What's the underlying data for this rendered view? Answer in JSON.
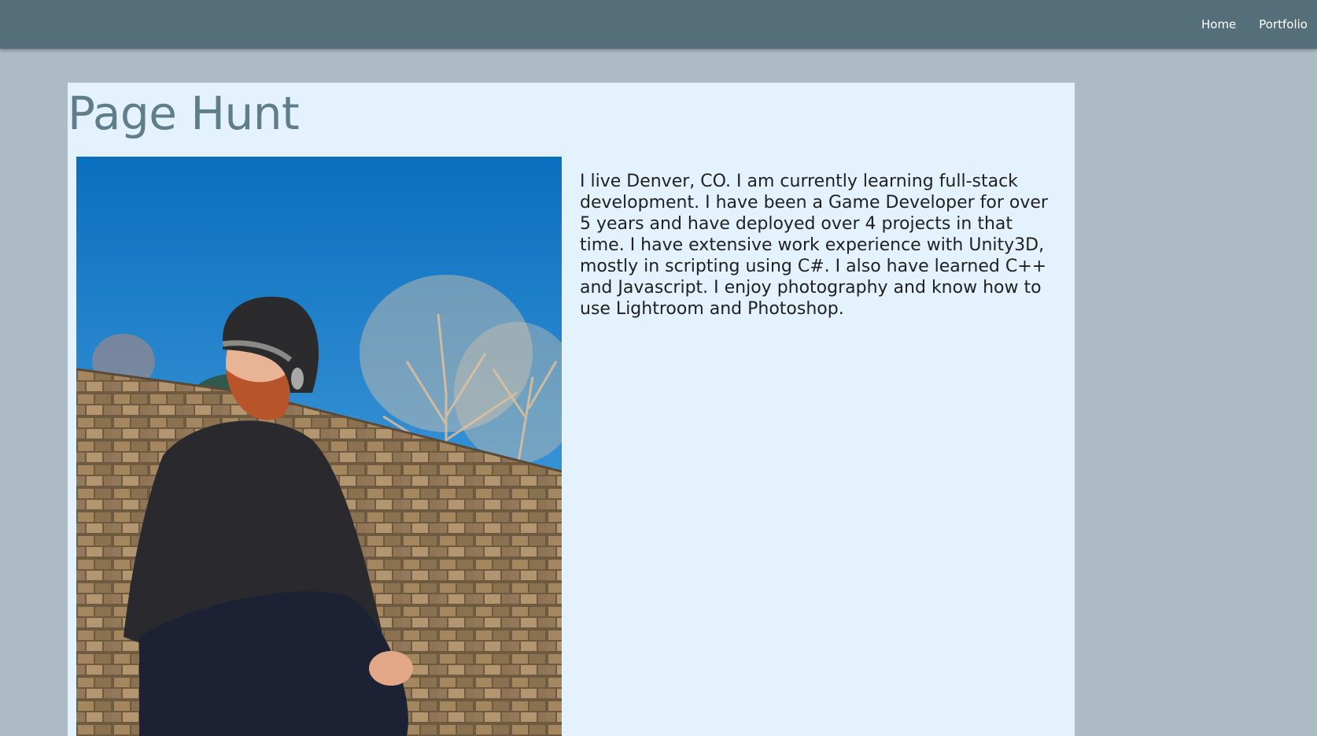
{
  "nav": {
    "items": [
      {
        "label": "Home"
      },
      {
        "label": "Portfolio"
      }
    ]
  },
  "profile": {
    "name": "Page Hunt",
    "bio": "I live Denver, CO. I am currently learning full-stack development. I have been a Game Developer for over 5 years and have deployed over 4 projects in that time. I have extensive work experience with Unity3D, mostly in scripting using C#. I also have learned C++ and Javascript. I enjoy photography and know how to use Lightroom and Photoshop."
  },
  "colors": {
    "navbar": "#546e7a",
    "page_background": "#adbcc4",
    "card_background": "#e3f2fd",
    "title": "#607d8b"
  }
}
